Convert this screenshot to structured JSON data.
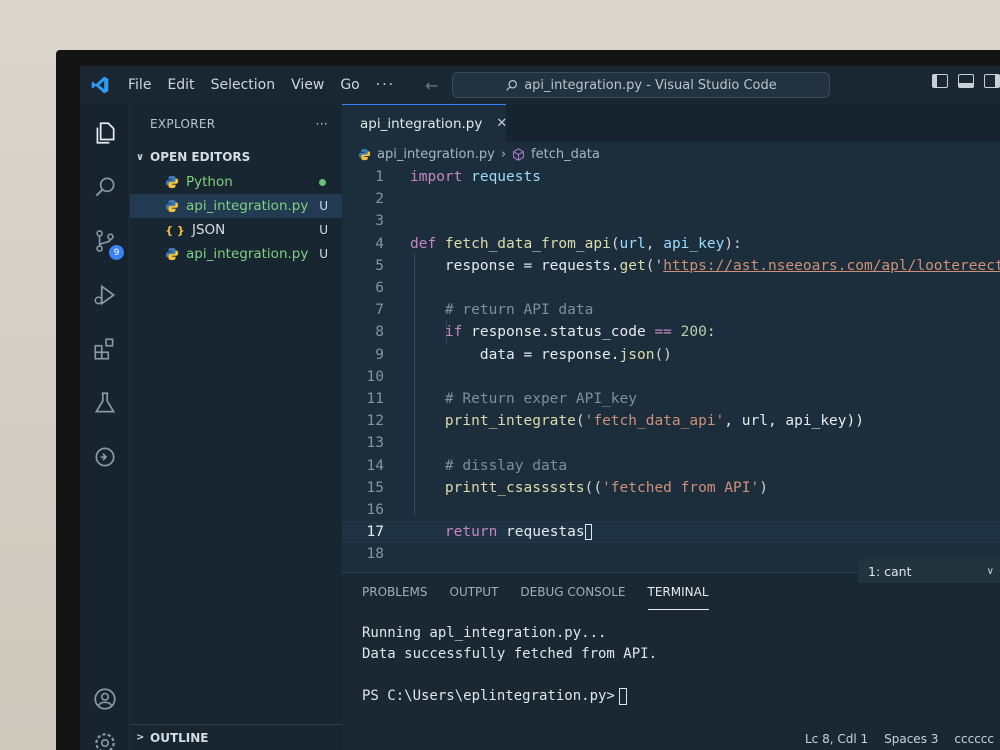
{
  "window": {
    "title": "api_integration.py - Visual Studio Code",
    "menu": [
      "File",
      "Edit",
      "Selection",
      "View",
      "Go"
    ],
    "more": "···"
  },
  "activity": {
    "source_control_badge": "9"
  },
  "sidebar": {
    "title": "EXPLORER",
    "more": "···",
    "section": "OPEN EDITORS",
    "files": [
      {
        "name": "Python",
        "status": "",
        "kind": "py"
      },
      {
        "name": "api_integration.py",
        "status": "U",
        "kind": "py"
      },
      {
        "name": "JSON",
        "status": "U",
        "kind": "json"
      },
      {
        "name": "api_integration.py",
        "status": "U",
        "kind": "py"
      }
    ],
    "outline": "OUTLINE",
    "json_icon": "{ }"
  },
  "editor": {
    "tab_label": "api_integration.py",
    "breadcrumb": {
      "file": "api_integration.py",
      "symbol": "fetch_data"
    },
    "line_numbers": [
      "1",
      "2",
      "3",
      "4",
      "5",
      "6",
      "7",
      "8",
      "9",
      "10",
      "11",
      "12",
      "13",
      "14",
      "15",
      "16",
      "17",
      "18"
    ],
    "code": {
      "l1_kw": "import",
      "l1_mod": " requests",
      "l4_kw": "def",
      "l4_fn": " fetch_data_from_api",
      "l4_p1": "(",
      "l4_a1": "url",
      "l4_p2": ", ",
      "l4_a2": "api_key",
      "l4_p3": "):",
      "l5_a": "    response = requests.",
      "l5_fn": "get",
      "l5_p1": "('",
      "l5_url": "https://ast.nseeoars.com/apl/lootereect",
      "l5_p2": "')",
      "l7_cmt": "    # return API data",
      "l8_kw": "    if",
      "l8_a": " response.status_code ",
      "l8_op": "==",
      "l8_num": " 200",
      "l8_p": ":",
      "l9_a": "        data = response.",
      "l9_fn": "json",
      "l9_p": "()",
      "l11_cmt": "    # Return exper API_key",
      "l12_fn": "    print_integrate",
      "l12_p1": "(",
      "l12_str": "'fetch_data_api'",
      "l12_p2": ", url, api_key))",
      "l14_cmt": "    # disslay data",
      "l15_fn": "    printt_csassssts",
      "l15_p1": "((",
      "l15_str": "'fetched from API'",
      "l15_p2": ")",
      "l17_kw": "    return",
      "l17_a": " requestas"
    }
  },
  "panel": {
    "tabs": [
      "PROBLEMS",
      "OUTPUT",
      "DEBUG CONSOLE",
      "TERMINAL"
    ],
    "active_tab": "TERMINAL",
    "terminal_select": "1: cant",
    "terminal_lines": [
      "Running apl_integration.py...",
      "Data successfully fetched from API.",
      "PS C:\\Users\\eplintegration.py>"
    ]
  },
  "status": {
    "position": "Lc 8, Cdl 1",
    "spaces": "Spaces 3",
    "encoding": "ϲϲϲϲϲϲ"
  }
}
